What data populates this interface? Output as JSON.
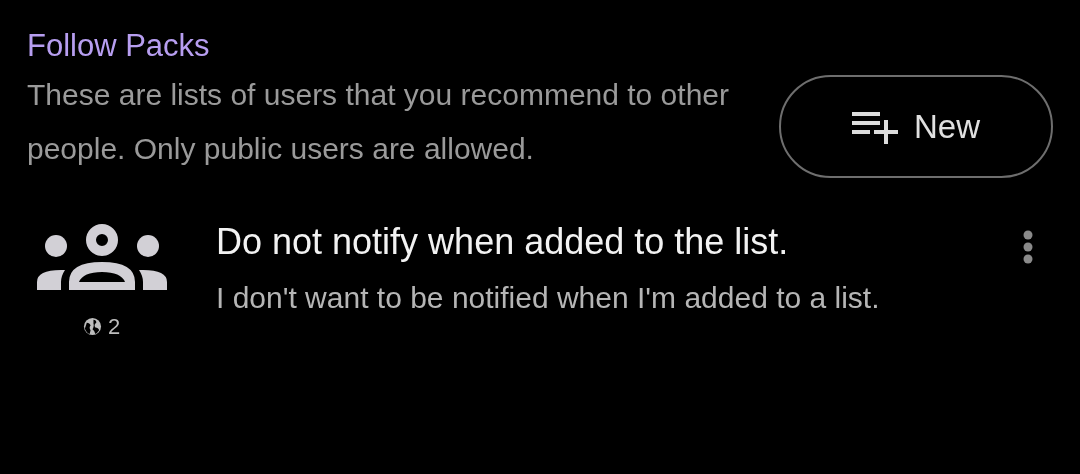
{
  "section": {
    "title": "Follow Packs",
    "description": "These are lists of users that you recommend to other people. Only public users are allowed.",
    "new_button": {
      "label": "New"
    }
  },
  "packs": [
    {
      "title": "Do not notify when added to the list.",
      "description": "I don't want to be notified when I'm added to a list.",
      "count": "2"
    }
  ]
}
